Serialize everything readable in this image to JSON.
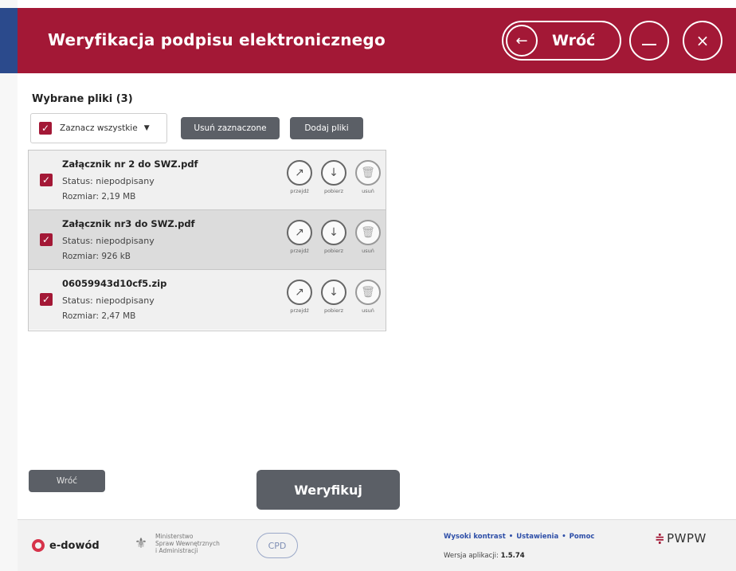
{
  "header": {
    "title": "Weryfikacja podpisu elektronicznego",
    "back_label": "Wróć",
    "back_icon": "←",
    "close_icon": "×"
  },
  "files_section": {
    "title": "Wybrane pliki (3)",
    "select_all_label": "Zaznacz wszystkie",
    "select_all_caret": "▼",
    "remove_selected_label": "Usuń zaznaczone",
    "add_files_label": "Dodaj pliki"
  },
  "files": [
    {
      "name": "Załącznik nr 2 do SWZ.pdf",
      "status": "Status: niepodpisany",
      "size": "Rozmiar: 2,19 MB"
    },
    {
      "name": "Załącznik nr3 do SWZ.pdf",
      "status": "Status: niepodpisany",
      "size": "Rozmiar: 926 kB"
    },
    {
      "name": "06059943d10cf5.zip",
      "status": "Status: niepodpisany",
      "size": "Rozmiar: 2,47 MB"
    }
  ],
  "file_actions": {
    "open_label": "przejdź",
    "download_label": "pobierz",
    "delete_label": "usuń",
    "open_icon": "↗",
    "download_icon": "↓",
    "delete_icon": "🗑",
    "checkbox_mark": "✓"
  },
  "bottom": {
    "back_label": "Wróć",
    "verify_label": "Weryfikuj"
  },
  "footer": {
    "edowod_label": "e-dowód",
    "mswia_line1": "Ministerstwo",
    "mswia_line2": "Spraw Wewnętrznych",
    "mswia_line3": "i Administracji",
    "cpd_label": "CPD",
    "link_contrast": "Wysoki kontrast",
    "link_settings": "Ustawienia",
    "link_help": "Pomoc",
    "link_separator": "•",
    "version_label": "Wersja aplikacji:",
    "version_value": "1.5.74",
    "pwpw_label": "PWPW"
  },
  "colors": {
    "brand_red": "#a31836",
    "button_gray": "#5b5f66",
    "link_blue": "#2e4fa8"
  }
}
